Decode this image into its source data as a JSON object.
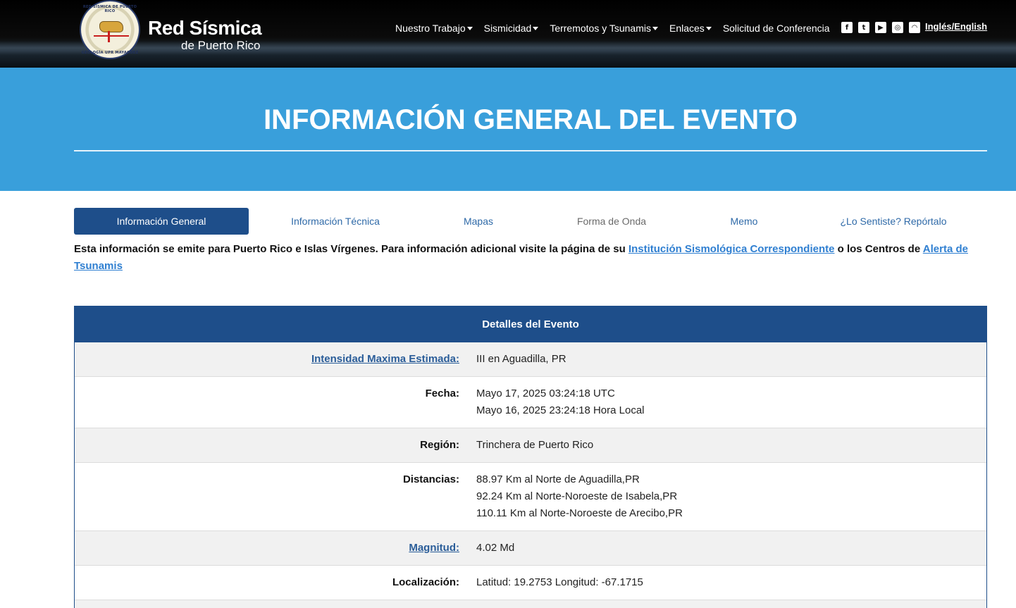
{
  "header": {
    "brand_title": "Red Sísmica",
    "brand_subtitle": "de Puerto Rico",
    "seal_top_text": "RED SÍSMICA DE PUERTO RICO",
    "seal_bottom_text": "GEOLOGÍA UPR MAYAGÜEZ",
    "nav": [
      {
        "label": "Nuestro Trabajo",
        "dropdown": true
      },
      {
        "label": "Sismicidad",
        "dropdown": true
      },
      {
        "label": "Terremotos y Tsunamis",
        "dropdown": true
      },
      {
        "label": "Enlaces",
        "dropdown": true
      },
      {
        "label": "Solicitud de Conferencia",
        "dropdown": false
      }
    ],
    "social_icons": [
      "facebook-icon",
      "twitter-icon",
      "youtube-icon",
      "instagram-icon",
      "rss-icon"
    ],
    "language_link": "Inglés/English"
  },
  "hero": {
    "title": "INFORMACIÓN GENERAL DEL EVENTO"
  },
  "tabs": [
    {
      "label": "Información General",
      "active": true
    },
    {
      "label": "Información Técnica",
      "active": false
    },
    {
      "label": "Mapas",
      "active": false
    },
    {
      "label": "Forma de Onda",
      "active": false,
      "muted": true
    },
    {
      "label": "Memo",
      "active": false
    },
    {
      "label": "¿Lo Sentiste? Repórtalo",
      "active": false
    }
  ],
  "notice": {
    "text_before": "Esta información se emite para Puerto Rico e Islas Vírgenes. Para información adicional visite la página de su ",
    "link1": "Institución Sismológica Correspondiente",
    "text_middle": " o los Centros de ",
    "link2": "Alerta de Tsunamis"
  },
  "details": {
    "heading": "Detalles del Evento",
    "rows": [
      {
        "label": "Intensidad Maxima Estimada:",
        "label_link": true,
        "values": [
          "III en Aguadilla, PR"
        ]
      },
      {
        "label": "Fecha:",
        "label_link": false,
        "values": [
          "Mayo 17, 2025 03:24:18 UTC",
          "Mayo 16, 2025 23:24:18 Hora Local"
        ]
      },
      {
        "label": "Región:",
        "label_link": false,
        "values": [
          "Trinchera de Puerto Rico"
        ]
      },
      {
        "label": "Distancias:",
        "label_link": false,
        "values": [
          "88.97 Km al Norte de Aguadilla,PR",
          "92.24 Km al Norte-Noroeste de Isabela,PR",
          "110.11 Km al Norte-Noroeste de Arecibo,PR"
        ]
      },
      {
        "label": "Magnitud:",
        "label_link": true,
        "values": [
          "4.02 Md"
        ]
      },
      {
        "label": "Localización:",
        "label_link": false,
        "values": [
          "Latitud: 19.2753 Longitud: -67.1715"
        ]
      }
    ]
  }
}
